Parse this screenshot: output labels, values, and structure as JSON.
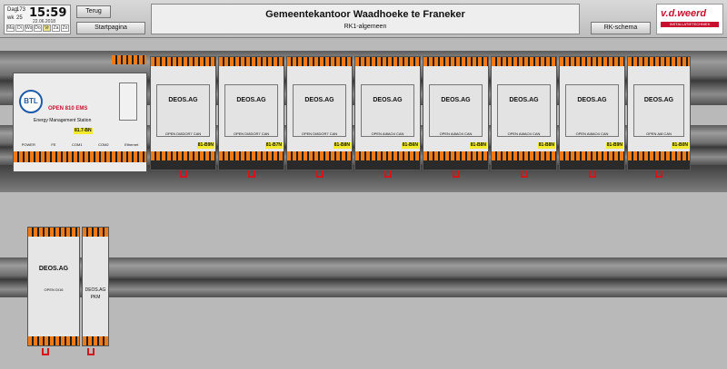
{
  "header": {
    "clock": {
      "day_label": "Dag",
      "day_of_year": "173",
      "time": "15:59",
      "date": "22.06.2018",
      "week_label": "wk",
      "week_number": "25",
      "weekdays": [
        "Ma",
        "Di",
        "Wo",
        "Do",
        "Vr",
        "Za",
        "Zo"
      ]
    },
    "buttons": {
      "back": "Terug",
      "home": "Startpagina",
      "rk_schema": "RK-schema"
    },
    "title": "Gemeentekantoor Waadhoeke te Franeker",
    "subtitle": "RK1-algemeen",
    "logo_text": "v.d.weerd",
    "logo_sub": "INSTALLATIETECHNIEK"
  },
  "main_module": {
    "brand": "BTL",
    "model": "OPEN 810 EMS",
    "subtitle": "Energy Management Station",
    "port_labels": [
      "POWER",
      "FE",
      "COM1",
      "COM2",
      "Ethernet"
    ],
    "address_tag": "81.7-BN"
  },
  "modules": [
    {
      "name": "OPEN DI8DOR7 CAN",
      "brand": "DEOS.AG",
      "tag": "81-B9N"
    },
    {
      "name": "OPEN DI8DOR7 CAN",
      "brand": "DEOS.AG",
      "tag": "81-B7N"
    },
    {
      "name": "OPEN DI8DOR7 CAN",
      "brand": "DEOS.AG",
      "tag": "81-B8N"
    },
    {
      "name": "OPEN AI8AO4 CAN",
      "brand": "DEOS.AG",
      "tag": "81-B6N"
    },
    {
      "name": "OPEN AI8AO4 CAN",
      "brand": "DEOS.AG",
      "tag": "81-B8N"
    },
    {
      "name": "OPEN AI8AO4 CAN",
      "brand": "DEOS.AG",
      "tag": "81-B8N"
    },
    {
      "name": "OPEN AI8AO4 CAN",
      "brand": "DEOS.AG",
      "tag": "81-B9N"
    },
    {
      "name": "OPEN AI8 CAN",
      "brand": "DEOS.AG",
      "tag": "81-B0N"
    }
  ],
  "lower_modules": [
    {
      "name": "OPEN DI16",
      "brand": "DEOS.AG"
    },
    {
      "name": "PKM",
      "brand": "DEOS.AG"
    }
  ]
}
